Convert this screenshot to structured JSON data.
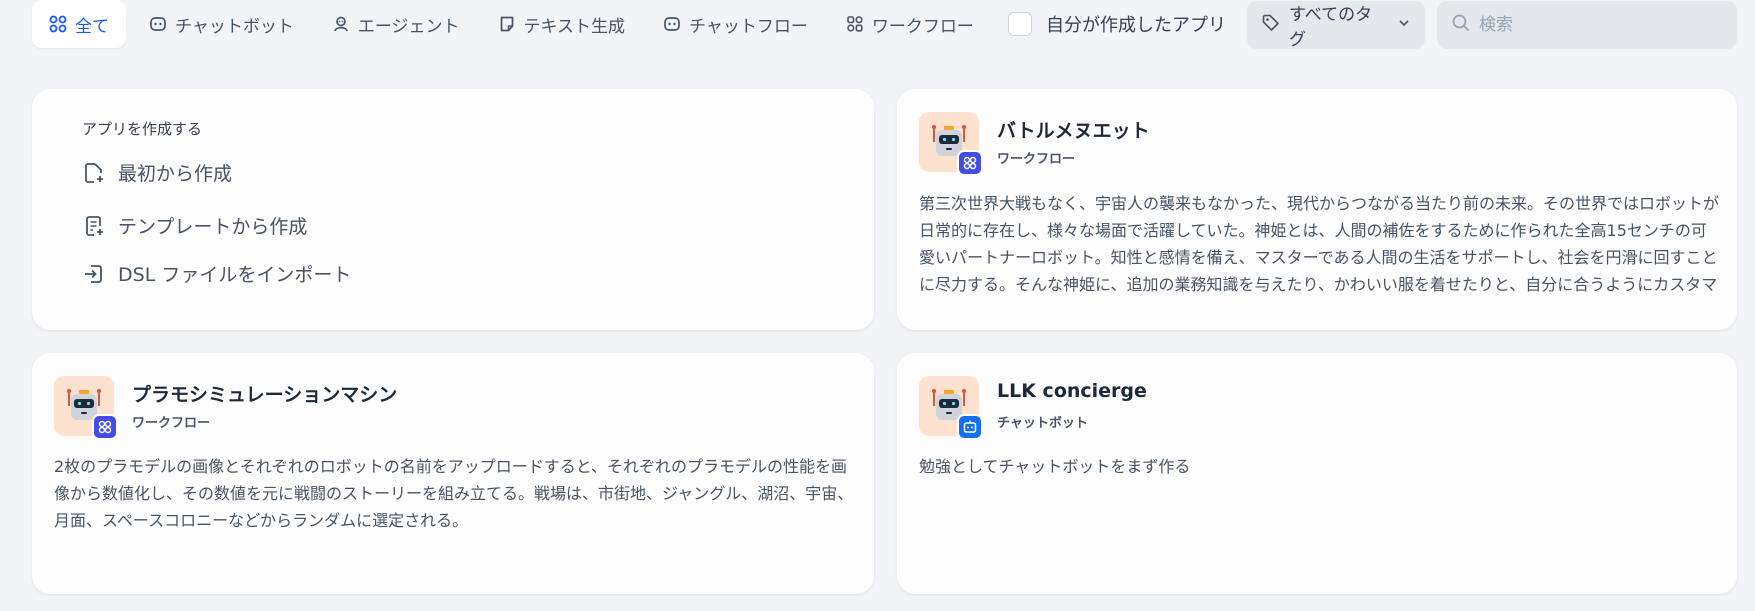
{
  "tabs": [
    {
      "label": "全て",
      "icon": "grid-icon",
      "active": true
    },
    {
      "label": "チャットボット",
      "icon": "chat-bot-icon"
    },
    {
      "label": "エージェント",
      "icon": "agent-icon"
    },
    {
      "label": "テキスト生成",
      "icon": "text-doc-icon"
    },
    {
      "label": "チャットフロー",
      "icon": "chatflow-icon"
    },
    {
      "label": "ワークフロー",
      "icon": "workflow-icon"
    }
  ],
  "filters": {
    "my_apps_label": "自分が作成したアプリ",
    "tags_label": "すべてのタグ",
    "search_placeholder": "検索"
  },
  "create": {
    "title": "アプリを作成する",
    "items": [
      {
        "label": "最初から作成",
        "icon": "file-plus-icon"
      },
      {
        "label": "テンプレートから作成",
        "icon": "template-icon"
      },
      {
        "label": "DSL ファイルをインポート",
        "icon": "import-icon"
      }
    ]
  },
  "apps": [
    {
      "name": "バトルメヌエット",
      "type": "ワークフロー",
      "badge": "workflow-badge-icon",
      "badge_color": "#444ce7",
      "description": "第三次世界大戦もなく、宇宙人の襲来もなかった、現代からつながる当たり前の未来。その世界ではロボットが日常的に存在し、様々な場面で活躍していた。神姫とは、人間の補佐をするために作られた全高15センチの可愛いパートナーロボット。知性と感情を備え、マスターである人間の生活をサポートし、社会を円滑に回すことに尽力する。そんな神姫に、追加の業務知識を与えたり、かわいい服を着せたりと、自分に合うようにカスタマイズする人々…"
    },
    {
      "name": "プラモシミュレーションマシン",
      "type": "ワークフロー",
      "badge": "workflow-badge-icon",
      "badge_color": "#444ce7",
      "description": "2枚のプラモデルの画像とそれぞれのロボットの名前をアップロードすると、それぞれのプラモデルの性能を画像から数値化し、その数値を元に戦闘のストーリーを組み立てる。戦場は、市街地、ジャングル、湖沼、宇宙、月面、スペースコロニーなどからランダムに選定される。"
    },
    {
      "name": "LLK concierge",
      "type": "チャットボット",
      "badge": "chatbot-badge-icon",
      "badge_color": "#1570ef",
      "description": "勉強としてチャットボットをまず作る"
    }
  ],
  "colors": {
    "accent": "#155aef",
    "background": "#f2f4f7",
    "avatar_bg": "#fde3cf"
  }
}
